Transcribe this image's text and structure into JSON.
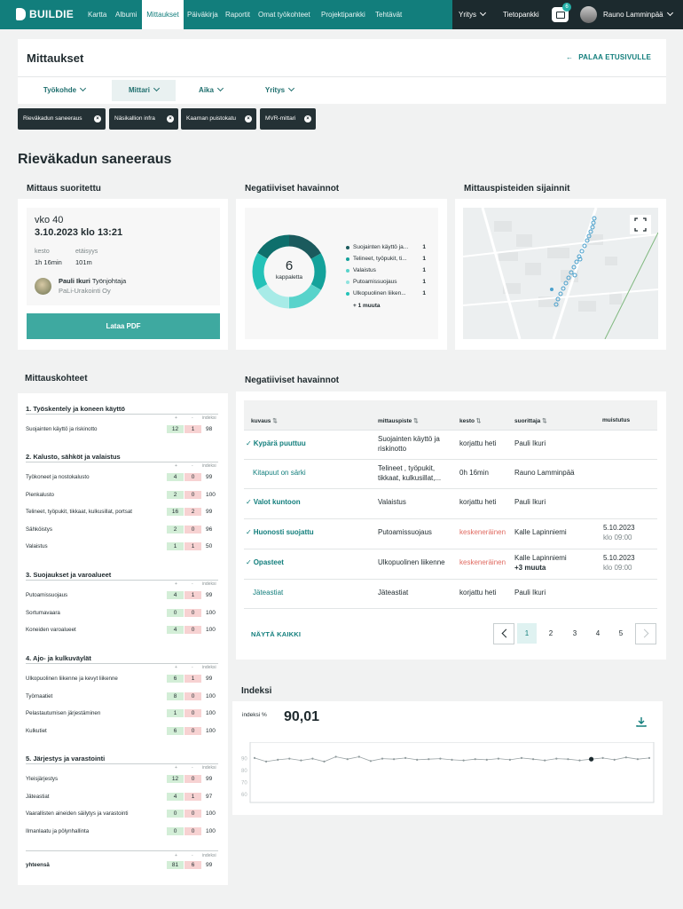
{
  "nav": {
    "logo": "BUILDIE",
    "items": [
      "Kartta",
      "Albumi",
      "Mittaukset",
      "Päiväkirja",
      "Raportit",
      "Omat työkohteet",
      "Projektipankki",
      "Tehtävät"
    ],
    "active": "Mittaukset",
    "company": "Yritys",
    "bank": "Tietopankki",
    "badge": "6",
    "user": "Rauno Lamminpää"
  },
  "header": {
    "title": "Mittaukset",
    "back": "PALAA ETUSIVULLE",
    "filters": [
      "Työkohde",
      "Mittari",
      "Aika",
      "Yritys"
    ],
    "chips": [
      "Rieväkadun saneeraus",
      "Näsikallion infra",
      "Kaarnan puistokatu",
      "MVR-mittari"
    ]
  },
  "page_title": "Rieväkadun saneeraus",
  "done": {
    "title": "Mittaus suoritettu",
    "week": "vko 40",
    "datetime": "3.10.2023 klo 13:21",
    "duration_label": "kesto",
    "duration": "1h 16min",
    "distance_label": "etäisyys",
    "distance": "101m",
    "person_name": "Pauli Ikuri",
    "person_role": "Työnjohtaja",
    "company": "PaLi-Urakointi Oy",
    "pdf": "Lataa PDF"
  },
  "neg_summary": {
    "title": "Negatiiviset havainnot",
    "count": "6",
    "count_label": "kappaletta",
    "items": [
      {
        "label": "Suojainten käyttö ja...",
        "count": "1",
        "color": "#1b5a5d"
      },
      {
        "label": "Telineet, työpukit, ti...",
        "count": "1",
        "color": "#14a29b"
      },
      {
        "label": "Valaistus",
        "count": "1",
        "color": "#58d3cb"
      },
      {
        "label": "Putoamissuojaus",
        "count": "1",
        "color": "#8fe3de"
      },
      {
        "label": "Ulkopuolinen liiken...",
        "count": "1",
        "color": "#24c2b8"
      }
    ],
    "more": "+ 1 muuta"
  },
  "map": {
    "title": "Mittauspisteiden sijainnit"
  },
  "targets": {
    "title": "Mittauskohteet",
    "col_plus": "+",
    "col_minus": "-",
    "col_index": "indeksi",
    "groups": [
      {
        "name": "1. Työskentely ja koneen käyttö",
        "rows": [
          [
            "Suojainten käyttö ja riskinotto",
            "12",
            "1",
            "98"
          ]
        ]
      },
      {
        "name": "2. Kalusto, sähköt ja valaistus",
        "rows": [
          [
            "Työkoneet ja nostokalusto",
            "4",
            "0",
            "99"
          ],
          [
            "Pienkalusto",
            "2",
            "0",
            "100"
          ],
          [
            "Telineet, työpukit, tikkaat, kulkusillat, portsat",
            "16",
            "2",
            "99"
          ],
          [
            "Sähköistys",
            "2",
            "0",
            "96"
          ],
          [
            "Valaistus",
            "1",
            "1",
            "50"
          ]
        ]
      },
      {
        "name": "3. Suojaukset ja varoalueet",
        "rows": [
          [
            "Putoamissuojaus",
            "4",
            "1",
            "99"
          ],
          [
            "Sortumavaara",
            "0",
            "0",
            "100"
          ],
          [
            "Koneiden varoalueet",
            "4",
            "0",
            "100"
          ]
        ]
      },
      {
        "name": "4. Ajo- ja kulkuväylät",
        "rows": [
          [
            "Ulkopuolinen liikenne ja kevyt liikenne",
            "6",
            "1",
            "99"
          ],
          [
            "Työmaatiet",
            "8",
            "0",
            "100"
          ],
          [
            "Pelastautumisen järjestäminen",
            "1",
            "0",
            "100"
          ],
          [
            "Kulkutiet",
            "6",
            "0",
            "100"
          ]
        ]
      },
      {
        "name": "5. Järjestys ja varastointi",
        "rows": [
          [
            "Yleisjärjestys",
            "12",
            "0",
            "99"
          ],
          [
            "Jäteastiat",
            "4",
            "1",
            "97"
          ],
          [
            "Vaarallisten aineiden säilytys ja varastointi",
            "0",
            "0",
            "100"
          ],
          [
            "Ilmanlaatu ja pölynhallinta",
            "0",
            "0",
            "100"
          ]
        ]
      }
    ],
    "total_label": "yhteensä",
    "total": [
      "81",
      "6",
      "99"
    ]
  },
  "neg_table": {
    "title": "Negatiiviset havainnot",
    "headers": [
      "kuvaus",
      "mittauspiste",
      "kesto",
      "suorittaja",
      "muistutus"
    ],
    "rows": [
      {
        "desc": "Kypärä puuttuu",
        "checked": true,
        "point": "Suojainten käyttö ja riskinotto",
        "duration": "korjattu heti",
        "status": "ok",
        "person": "Pauli Ikuri",
        "person2": "",
        "reminder": "",
        "reminder2": ""
      },
      {
        "desc": "Kitapuut on särki",
        "checked": false,
        "point": "Telineet , työpukit, tikkaat, kulkusillat,...",
        "duration": "0h 16min",
        "status": "ok",
        "person": "Rauno Lamminpää",
        "person2": "",
        "reminder": "",
        "reminder2": ""
      },
      {
        "desc": "Valot kuntoon",
        "checked": true,
        "point": "Valaistus",
        "duration": "korjattu heti",
        "status": "ok",
        "person": "Pauli Ikuri",
        "person2": "",
        "reminder": "",
        "reminder2": ""
      },
      {
        "desc": "Huonosti suojattu",
        "checked": true,
        "point": "Putoamissuojaus",
        "duration": "keskeneräinen",
        "status": "warn",
        "person": "Kalle Lapinniemi",
        "person2": "",
        "reminder": "5.10.2023",
        "reminder2": "klo 09:00"
      },
      {
        "desc": "Opasteet",
        "checked": true,
        "point": "Ulkopuolinen liikenne",
        "duration": "keskeneräinen",
        "status": "warn",
        "person": "Kalle Lapinniemi",
        "person2": "+3 muuta",
        "reminder": "5.10.2023",
        "reminder2": "klo 09:00"
      },
      {
        "desc": "Jäteastiat",
        "checked": false,
        "point": "Jäteastiat",
        "duration": "korjattu heti",
        "status": "ok",
        "person": "Pauli Ikuri",
        "person2": "",
        "reminder": "",
        "reminder2": ""
      }
    ],
    "show_all": "NÄYTÄ KAIKKI",
    "pages": [
      "1",
      "2",
      "3",
      "4",
      "5"
    ],
    "active_page": "1"
  },
  "index": {
    "title": "Indeksi",
    "label": "indeksi %",
    "value": "90,01"
  },
  "chart_data": {
    "type": "line",
    "title": "",
    "xlabel": "",
    "ylabel": "",
    "ylim": [
      55,
      100
    ],
    "yticks": [
      "90",
      "80",
      "70",
      "60"
    ],
    "grid": false,
    "highlight_index": 29,
    "series": [
      {
        "values": [
          90.5,
          87.5,
          89,
          90,
          88.5,
          90,
          87.5,
          91.5,
          89.5,
          91.5,
          88,
          90,
          89.5,
          90.5,
          89,
          89.5,
          90,
          89,
          88.5,
          89.5,
          89,
          90,
          89,
          90.5,
          89.5,
          88.5,
          90,
          89.5,
          88.5,
          89.5,
          90.5,
          89,
          91,
          89.5,
          90.5
        ]
      }
    ]
  }
}
